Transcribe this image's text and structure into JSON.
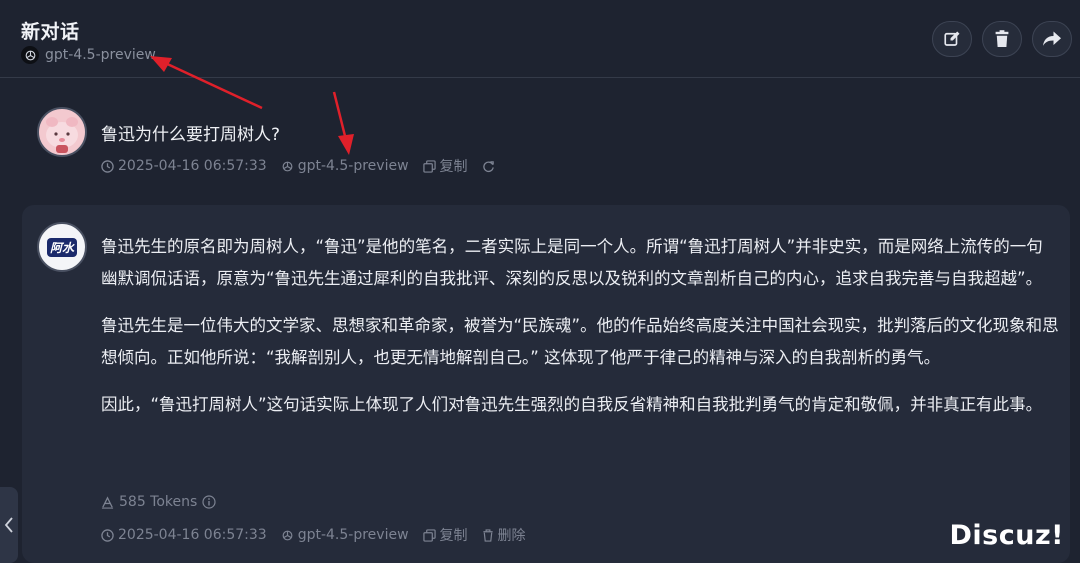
{
  "header": {
    "title": "新对话",
    "model": "gpt-4.5-preview",
    "actions": [
      {
        "name": "edit",
        "icon": "edit-icon"
      },
      {
        "name": "delete",
        "icon": "trash-icon"
      },
      {
        "name": "share",
        "icon": "share-icon"
      }
    ]
  },
  "user_message": {
    "text": "鲁迅为什么要打周树人?",
    "timestamp": "2025-04-16 06:57:33",
    "model": "gpt-4.5-preview",
    "copy_label": "复制"
  },
  "assistant_message": {
    "paragraphs": [
      "鲁迅先生的原名即为周树人，“鲁迅”是他的笔名，二者实际上是同一个人。所谓“鲁迅打周树人”并非史实，而是网络上流传的一句幽默调侃话语，原意为“鲁迅先生通过犀利的自我批评、深刻的反思以及锐利的文章剖析自己的内心，追求自我完善与自我超越”。",
      "鲁迅先生是一位伟大的文学家、思想家和革命家，被誉为“民族魂”。他的作品始终高度关注中国社会现实，批判落后的文化现象和思想倾向。正如他所说：“我解剖别人，也更无情地解剖自己。” 这体现了他严于律己的精神与深入的自我剖析的勇气。",
      "因此，“鲁迅打周树人”这句话实际上体现了人们对鲁迅先生强烈的自我反省精神和自我批判勇气的肯定和敬佩，并非真正有此事。"
    ],
    "tokens": "585 Tokens",
    "timestamp": "2025-04-16 06:57:33",
    "model": "gpt-4.5-preview",
    "copy_label": "复制",
    "delete_label": "删除",
    "avatar_logo": "阿水"
  },
  "watermark": "Discuz!",
  "colors": {
    "background": "#1e2330",
    "bubble": "#252b3a",
    "muted_text": "#7d8392",
    "arrow": "#e0202a"
  }
}
